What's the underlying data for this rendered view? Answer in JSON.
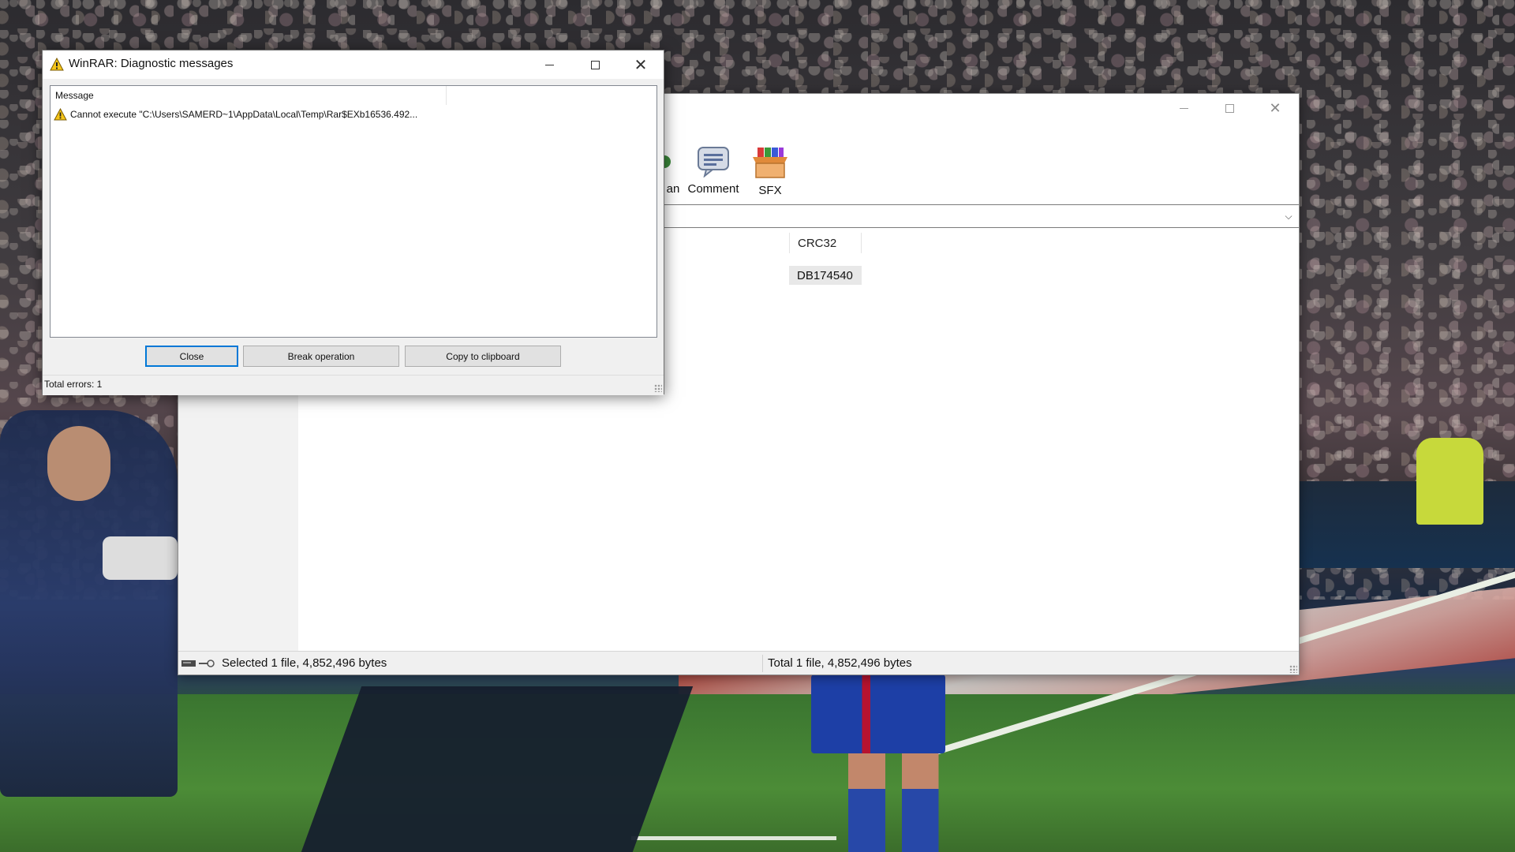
{
  "main_window": {
    "toolbar": {
      "scan_label_partial": "an",
      "comment_label": "Comment",
      "sfx_label": "SFX"
    },
    "file_list": {
      "columns": [
        "CRC32"
      ],
      "rows": [
        {
          "crc32": "DB174540"
        }
      ]
    },
    "status": {
      "selected": "Selected 1 file, 4,852,496 bytes",
      "total": "Total 1 file, 4,852,496 bytes"
    }
  },
  "diagnostic_dialog": {
    "title": "WinRAR: Diagnostic messages",
    "list_header": "Message",
    "messages": [
      {
        "icon": "warning-icon",
        "text": "Cannot execute \"C:\\Users\\SAMERD~1\\AppData\\Local\\Temp\\Rar$EXb16536.492..."
      }
    ],
    "buttons": {
      "close": "Close",
      "break": "Break operation",
      "copy": "Copy to clipboard"
    },
    "status": "Total errors: 1"
  },
  "colors": {
    "focus_accent": "#0078d7",
    "warning": "#f5c518"
  }
}
